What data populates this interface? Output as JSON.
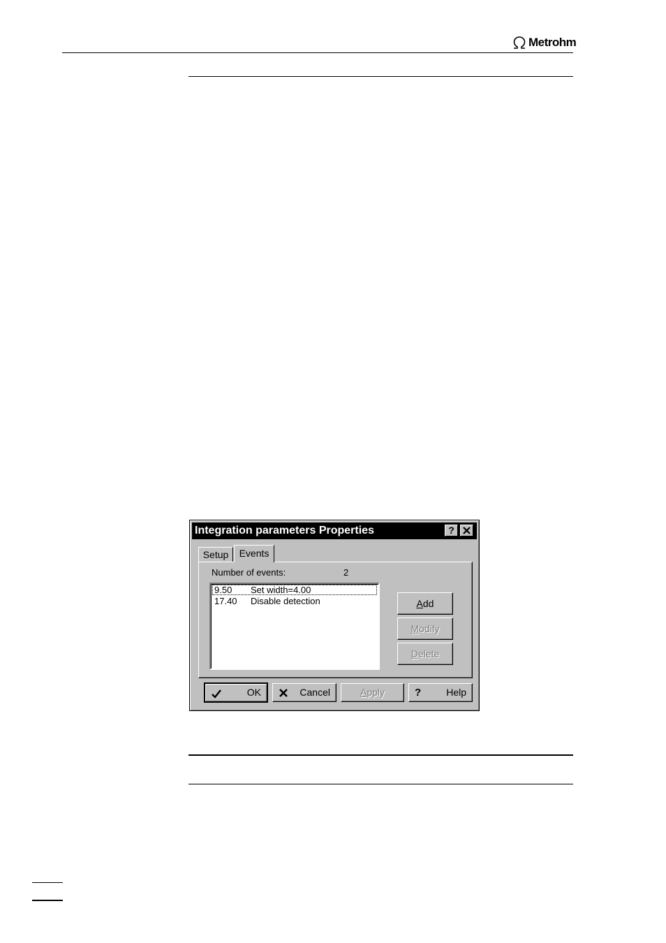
{
  "header": {
    "brand": "Metrohm",
    "brand_icon": "omega-icon"
  },
  "dialog": {
    "title": "Integration parameters Properties",
    "title_buttons": {
      "help": "?",
      "close": "✕"
    },
    "tabs": [
      {
        "label": "Setup",
        "selected": false
      },
      {
        "label": "Events",
        "selected": true
      }
    ],
    "events_label": "Number of events:",
    "events_count": "2",
    "events": [
      {
        "time": "9.50",
        "description": "Set width=4.00"
      },
      {
        "time": "17.40",
        "description": "Disable detection"
      }
    ],
    "side_buttons": {
      "add": {
        "label_u": "A",
        "label_rest": "dd"
      },
      "modify": {
        "label_u": "M",
        "label_rest": "odify"
      },
      "delete": {
        "label_u": "D",
        "label_rest": "elete"
      }
    },
    "bottom_buttons": {
      "ok": {
        "label": "OK",
        "icon": "checkmark-icon"
      },
      "cancel": {
        "label": "Cancel",
        "icon": "cross-icon"
      },
      "apply": {
        "label_u": "A",
        "label_rest": "pply"
      },
      "help": {
        "label": "Help",
        "icon": "question-icon"
      }
    }
  }
}
